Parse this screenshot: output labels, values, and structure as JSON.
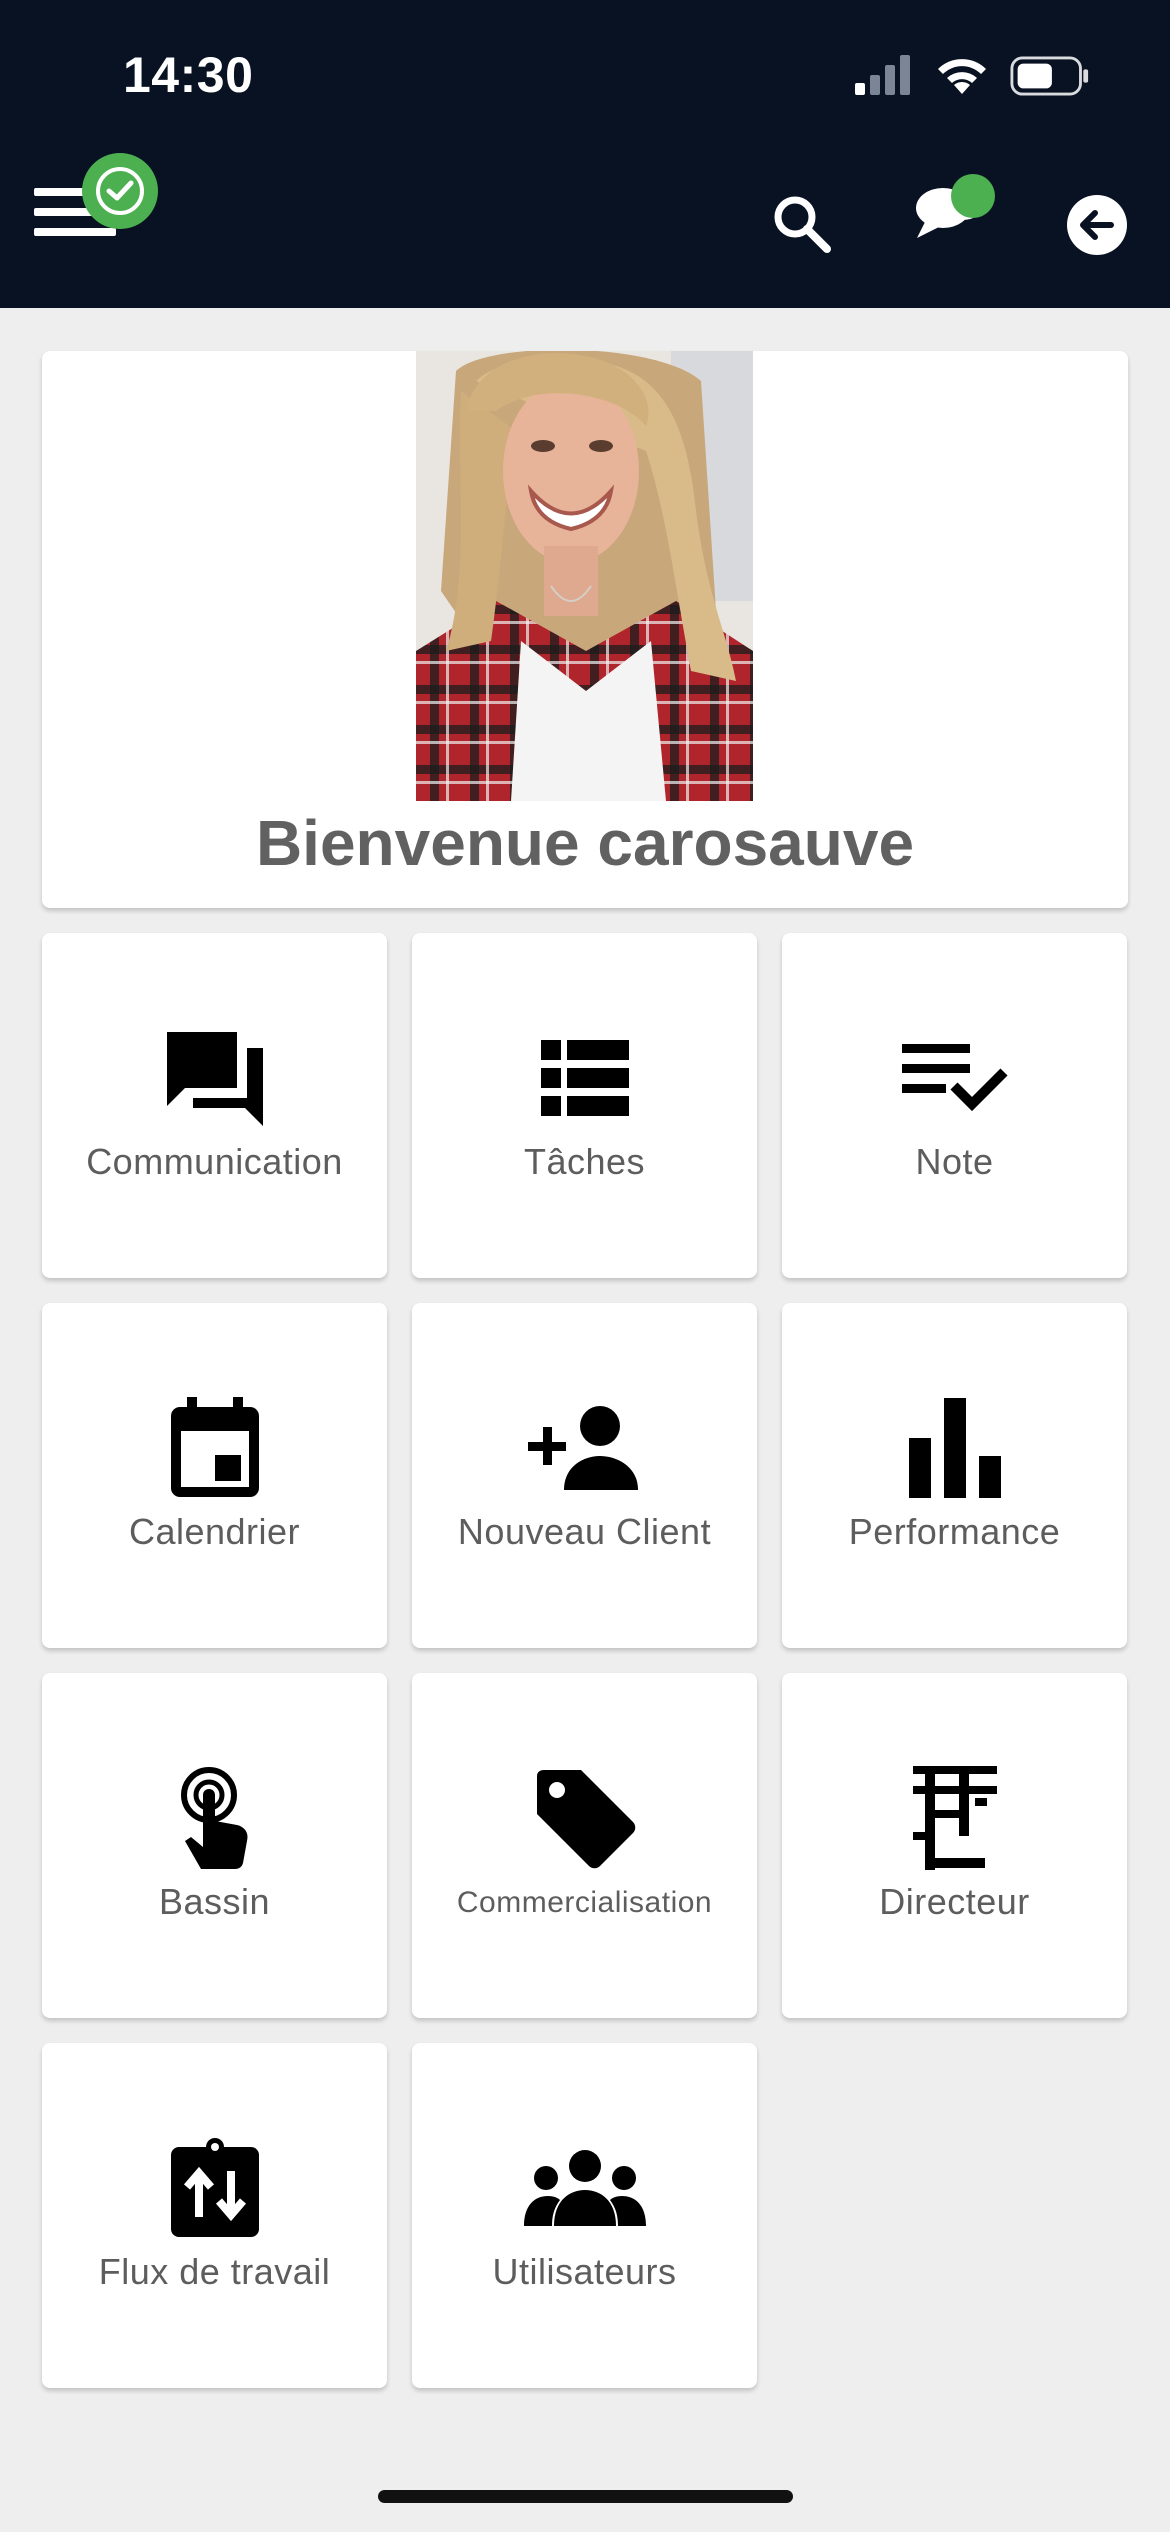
{
  "status_bar": {
    "time": "14:30"
  },
  "header": {
    "menu_icon": "hamburger-menu-icon",
    "status_badge_icon": "check-circle-icon",
    "search_icon": "search-icon",
    "chat_icon": "chat-bubbles-icon",
    "back_icon": "arrow-left-circle-icon",
    "badge_color": "#4caf50",
    "bar_color": "#091222"
  },
  "welcome": {
    "title": "Bienvenue carosauve",
    "photo": "profile-photo"
  },
  "tiles": [
    {
      "label": "Communication",
      "icon": "forum-icon"
    },
    {
      "label": "Tâches",
      "icon": "view-list-icon"
    },
    {
      "label": "Note",
      "icon": "playlist-check-icon"
    },
    {
      "label": "Calendrier",
      "icon": "calendar-icon"
    },
    {
      "label": "Nouveau Client",
      "icon": "person-add-icon"
    },
    {
      "label": "Performance",
      "icon": "bar-chart-icon"
    },
    {
      "label": "Bassin",
      "icon": "touch-icon"
    },
    {
      "label": "Commercialisation",
      "icon": "tag-icon"
    },
    {
      "label": "Directeur",
      "icon": "directeur-icon"
    },
    {
      "label": "Flux de travail",
      "icon": "swap-vertical-clipboard-icon"
    },
    {
      "label": "Utilisateurs",
      "icon": "groups-icon"
    }
  ]
}
